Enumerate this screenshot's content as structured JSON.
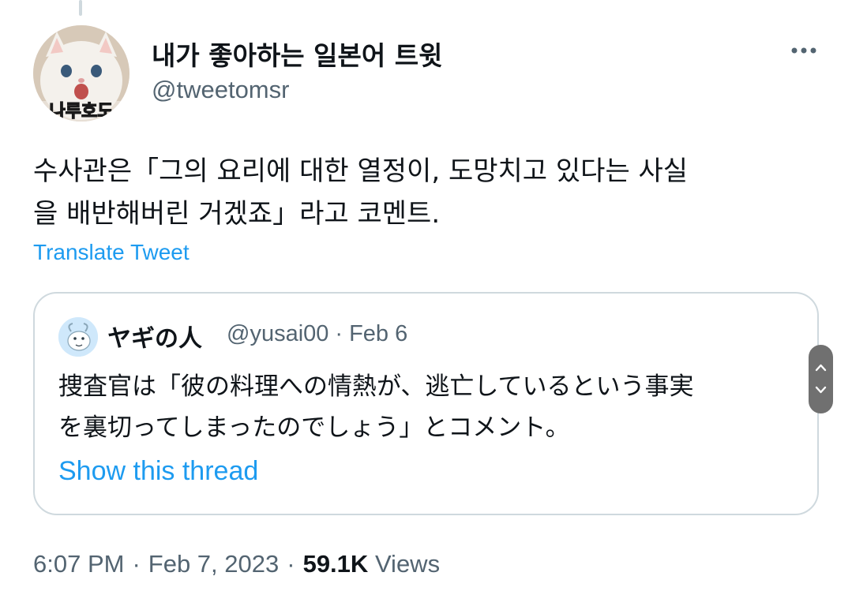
{
  "tweet": {
    "display_name": "내가 좋아하는 일본어 트윗",
    "handle": "@tweetomsr",
    "avatar_caption": "나루호도",
    "text": "수사관은「그의 요리에 대한 열정이, 도망치고 있다는 사실\n을 배반해버린 거겠죠」라고 코멘트.",
    "translate_label": "Translate Tweet",
    "time": "6:07 PM",
    "date": "Feb 7, 2023",
    "views_count": "59.1K",
    "views_label": "Views"
  },
  "quote": {
    "display_name": "ヤギの人",
    "handle": "@yusai00",
    "separator": "·",
    "date": "Feb 6",
    "text": "捜査官は「彼の料理への情熱が、逃亡しているという事実\nを裏切ってしまったのでしょう」とコメント。",
    "show_thread_label": "Show this thread"
  },
  "icons": {
    "more": "more-horizontal-icon",
    "scroll_up": "chevron-up-icon",
    "scroll_down": "chevron-down-icon"
  },
  "colors": {
    "link": "#1d9bf0",
    "secondary_text": "#536471",
    "primary_text": "#0f1419",
    "border": "#cfd9de"
  }
}
